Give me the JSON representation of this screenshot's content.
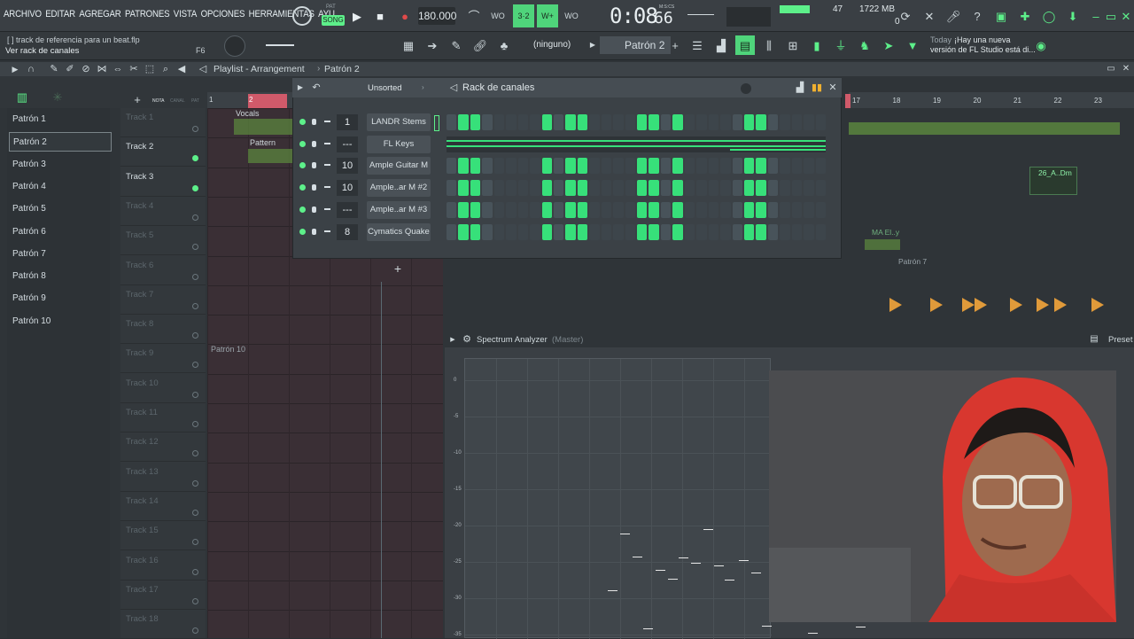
{
  "menu": [
    "ARCHIVO",
    "EDITAR",
    "AGREGAR",
    "PATRONES",
    "VISTA",
    "OPCIONES",
    "HERRAMIENTAS",
    "AYU"
  ],
  "transport": {
    "mode_pat": "PAT",
    "mode_song": "SONG",
    "tempo": "180.000",
    "time": "0:08",
    "time_sub": "66",
    "time_unit": "M:S:CS"
  },
  "monitor": {
    "cpu": "47",
    "memory": "1722 MB",
    "voices": "0"
  },
  "hint": {
    "line1": "[ ] track de referencia para un beat.flp",
    "line2": "Ver rack de canales",
    "key": "F6"
  },
  "toolbar": {
    "snap": "(ninguno)",
    "pattern": "Patrón 2"
  },
  "news": {
    "label": "Today",
    "text1": "¡Hay una nueva",
    "text2": "versión de FL Studio está di..."
  },
  "playlist": {
    "title": "Playlist - Arrangement",
    "breadcrumb": "Patrón 2"
  },
  "patterns": [
    "Patrón 1",
    "Patrón 2",
    "Patrón 3",
    "Patrón 4",
    "Patrón 5",
    "Patrón 6",
    "Patrón 7",
    "Patrón 8",
    "Patrón 9",
    "Patrón 10"
  ],
  "tabs": {
    "nota": "NOTA",
    "canal": "CANAL",
    "pat": "PAT"
  },
  "tracks": [
    "Track 1",
    "Track 2",
    "Track 3",
    "Track 4",
    "Track 5",
    "Track 6",
    "Track 7",
    "Track 8",
    "Track 9",
    "Track 10",
    "Track 11",
    "Track 12",
    "Track 13",
    "Track 14",
    "Track 15",
    "Track 16",
    "Track 17",
    "Track 18"
  ],
  "ruler": [
    "1",
    "2"
  ],
  "ruler_right": [
    "17",
    "18",
    "19",
    "20",
    "21",
    "22",
    "23"
  ],
  "clips": {
    "vocals": "Vocals",
    "pattern": "Pattern",
    "patron10": "Patrón 10",
    "dm": "26_A..Dm",
    "ma": "MA El..y",
    "patron7": "Patrón 7"
  },
  "rack": {
    "filter": "Unsorted",
    "title": "Rack de canales",
    "channels": [
      {
        "num": "1",
        "name": "LANDR Stems"
      },
      {
        "num": "---",
        "name": "FL Keys"
      },
      {
        "num": "10",
        "name": "Ample Guitar M"
      },
      {
        "num": "10",
        "name": "Ample..ar M #2"
      },
      {
        "num": "---",
        "name": "Ample..ar M #3"
      },
      {
        "num": "8",
        "name": "Cymatics Quake"
      }
    ]
  },
  "spectrum": {
    "title": "Spectrum Analyzer",
    "sub": "(Master)",
    "presets": "Preset",
    "ylabels": [
      "0",
      "-5",
      "-10",
      "-15",
      "-20",
      "-25",
      "-30",
      "-35"
    ]
  }
}
